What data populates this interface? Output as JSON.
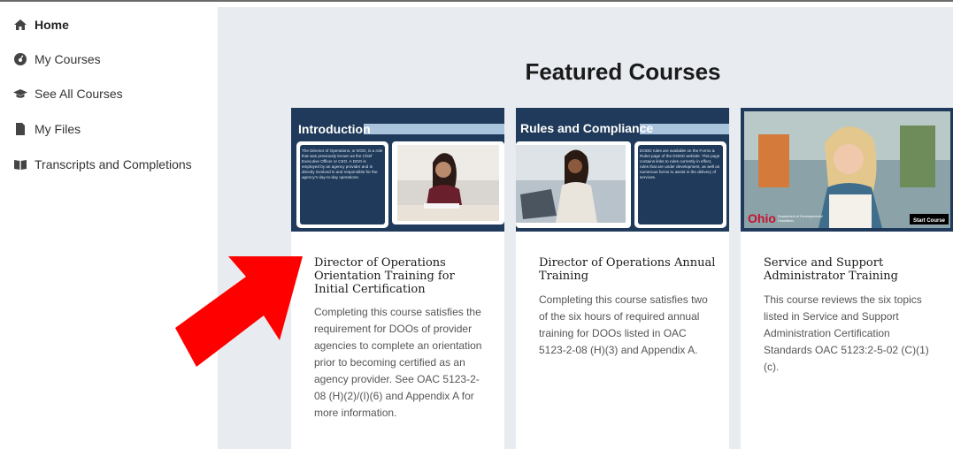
{
  "sidebar": {
    "items": [
      {
        "label": "Home",
        "icon": "home-icon"
      },
      {
        "label": "My Courses",
        "icon": "dashboard-icon"
      },
      {
        "label": "See All Courses",
        "icon": "graduation-cap-icon"
      },
      {
        "label": "My Files",
        "icon": "file-icon"
      },
      {
        "label": "Transcripts and Completions",
        "icon": "book-icon"
      }
    ]
  },
  "main": {
    "title": "Featured Courses",
    "cards": [
      {
        "thumb_heading": "Introduction",
        "thumb_text": "The Director of Operations, or DOO, is a role that was previously known as the Chief Executive Officer or CEO. A DOO is employed by an agency provider and is directly involved in and responsible for the agency's day-to-day operations.",
        "title": "Director of Operations Orientation Training for Initial Certification",
        "description": "Completing this course satisfies the requirement for DOOs of provider agencies to complete an orientation prior to becoming certified as an agency provider. See OAC 5123-2-08 (H)(2)/(I)(6) and Appendix A for more information."
      },
      {
        "thumb_heading": "Rules and Compliance",
        "thumb_text": "DODD rules are available on the Forms & Rules page of the DODD website. This page contains links to rules currently in effect, rules that are under development, as well as numerous forms to assist in the delivery of services.",
        "title": "Director of Operations Annual Training",
        "description": "Completing this course satisfies two of the six hours of required annual training for DOOs listed in OAC 5123-2-08 (H)(3) and Appendix A."
      },
      {
        "thumb_logo": "Ohio",
        "thumb_dept": "Department of Developmental Disabilities",
        "thumb_button": "Start Course",
        "title": "Service and Support Administrator Training",
        "description": "This course reviews the six topics listed in Service and Support Administration Certification Standards OAC 5123:2-5-02 (C)(1)(c)."
      }
    ]
  },
  "colors": {
    "navy": "#1f3a5a",
    "light_blue": "#a9c4dc",
    "arrow": "#ff0000",
    "ohio_red": "#c8102e",
    "background": "#e8ecf1"
  }
}
